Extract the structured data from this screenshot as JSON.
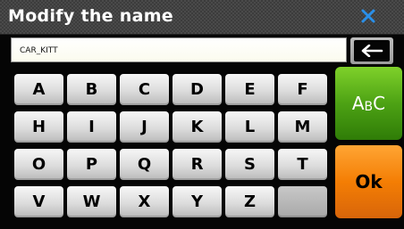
{
  "dialog": {
    "title": "Modify the name",
    "close_icon": "close-x-icon",
    "accent_color": "#2a8fe8"
  },
  "input": {
    "value": "CAR_KITT",
    "backspace_icon": "backspace-arrow-icon"
  },
  "keyboard": {
    "keys": [
      "A",
      "B",
      "C",
      "D",
      "E",
      "F",
      "H",
      "I",
      "J",
      "K",
      "L",
      "M",
      "O",
      "P",
      "Q",
      "R",
      "S",
      "T",
      "V",
      "W",
      "X",
      "Y",
      "Z",
      ""
    ]
  },
  "side_buttons": {
    "mode_label_upper_a": "A",
    "mode_label_lower_b": "B",
    "mode_label_upper_c": "C",
    "mode_color": "#4da214",
    "ok_label": "Ok",
    "ok_color": "#f47e04"
  }
}
